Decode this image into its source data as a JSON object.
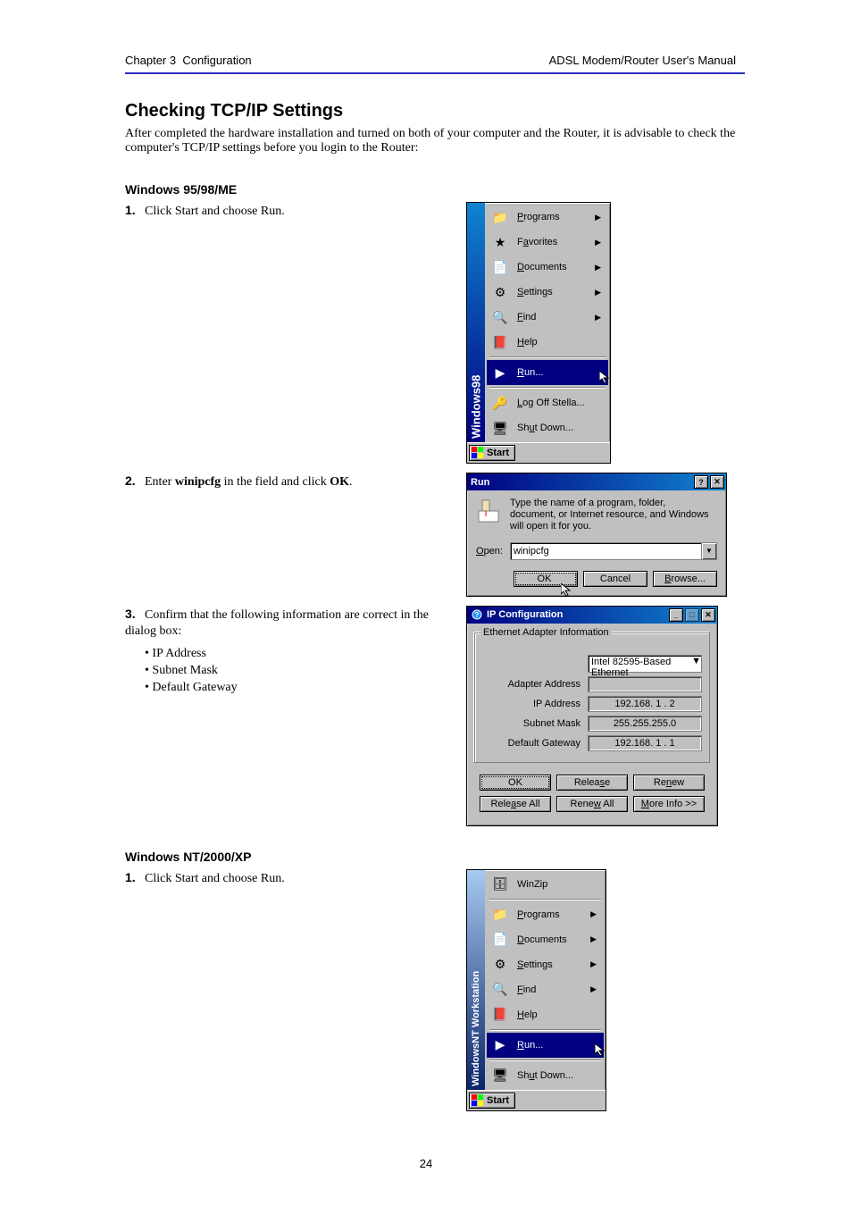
{
  "header": {
    "doc_title": "ADSL Modem/Router User's Manual",
    "chapter": "Chapter 3",
    "chapter_title": "Configuration",
    "page_number": "24"
  },
  "section": {
    "title": "Checking TCP/IP Settings",
    "intro": "After completed the hardware installation and turned on both of your computer and the Router, it is advisable to check the computer's TCP/IP settings before you login to the Router:"
  },
  "parts": {
    "win98": {
      "title": "Windows 95/98/ME",
      "step1": {
        "text": "Click Start and choose Run.",
        "menu_side": "Windows98",
        "start_btn": "Start",
        "items": [
          {
            "label": "Programs",
            "accel": "P",
            "arrow": true
          },
          {
            "label": "Favorites",
            "accel": "a",
            "arrow": true
          },
          {
            "label": "Documents",
            "accel": "D",
            "arrow": true
          },
          {
            "label": "Settings",
            "accel": "S",
            "arrow": true
          },
          {
            "label": "Find",
            "accel": "F",
            "arrow": true
          },
          {
            "label": "Help",
            "accel": "H",
            "arrow": false
          },
          {
            "label": "Run...",
            "accel": "R",
            "arrow": false,
            "selected": true
          },
          {
            "label": "Log Off Stella...",
            "accel": "L",
            "arrow": false
          },
          {
            "label": "Shut Down...",
            "accel": "u",
            "arrow": false
          }
        ]
      },
      "step2": {
        "text_1": "Enter ",
        "text_cmd": "winipcfg",
        "text_2": " in the field and click ",
        "text_bold": "OK",
        "text_3": ".",
        "dialog_title": "Run",
        "description": "Type the name of a program, folder, document, or Internet resource, and Windows will open it for you.",
        "open_label": "Open:",
        "open_value": "winipcfg",
        "ok_btn": "OK",
        "cancel_btn": "Cancel",
        "browse_btn": "Browse..."
      },
      "step3": {
        "text": "Confirm that the following information are correct in the dialog box:",
        "bullets": [
          "IP Address",
          "Subnet Mask",
          "Default Gateway"
        ],
        "dialog_title": "IP Configuration",
        "group_title": "Ethernet Adapter Information",
        "adapter_value": "Intel 82595-Based Ethernet",
        "fields": {
          "adapter_address_label": "Adapter Address",
          "adapter_address_value": "",
          "ip_label": "IP Address",
          "ip_value": "192.168. 1 . 2",
          "mask_label": "Subnet Mask",
          "mask_value": "255.255.255.0",
          "gw_label": "Default Gateway",
          "gw_value": "192.168. 1 . 1"
        },
        "buttons": {
          "ok": "OK",
          "release": "Release",
          "renew": "Renew",
          "release_all": "Release All",
          "renew_all": "Renew All",
          "more_info": "More Info >>"
        }
      }
    },
    "winnt": {
      "title": "Windows NT/2000/XP",
      "step1": {
        "text": "Click Start and choose Run.",
        "menu_side": "WindowsNT Workstation",
        "start_btn": "Start",
        "top_item": "WinZip",
        "items": [
          {
            "label": "Programs",
            "accel": "P",
            "arrow": true
          },
          {
            "label": "Documents",
            "accel": "D",
            "arrow": true
          },
          {
            "label": "Settings",
            "accel": "S",
            "arrow": true
          },
          {
            "label": "Find",
            "accel": "F",
            "arrow": true
          },
          {
            "label": "Help",
            "accel": "H",
            "arrow": false
          },
          {
            "label": "Run...",
            "accel": "R",
            "arrow": false,
            "selected": true
          },
          {
            "label": "Shut Down...",
            "accel": "u",
            "arrow": false
          }
        ]
      }
    }
  }
}
